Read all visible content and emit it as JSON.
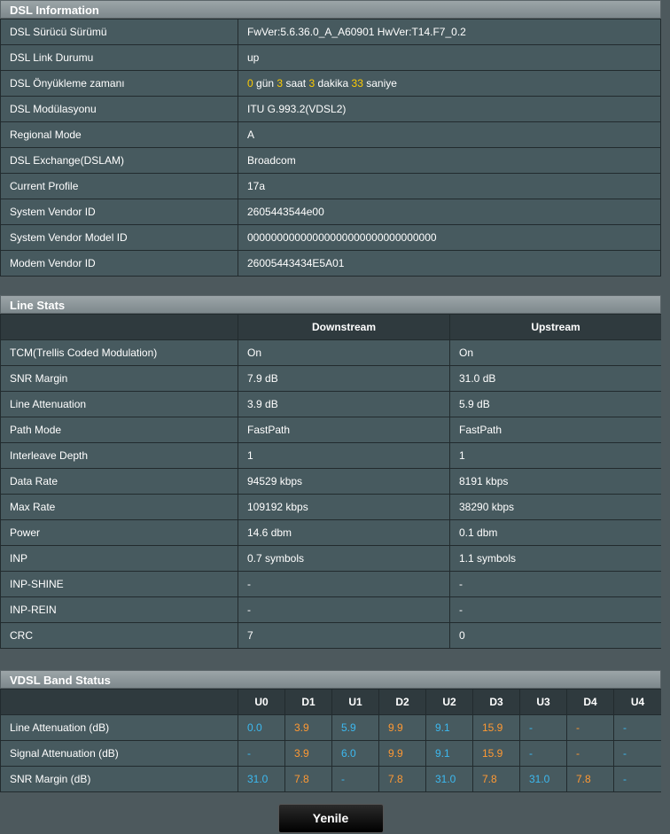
{
  "dsl_info": {
    "title": "DSL Information",
    "rows": [
      {
        "label": "DSL Sürücü Sürümü",
        "value": "FwVer:5.6.36.0_A_A60901 HwVer:T14.F7_0.2"
      },
      {
        "label": "DSL Link Durumu",
        "value": "up"
      },
      {
        "label": "DSL Önyükleme zamanı",
        "uptime": {
          "days": "0",
          "days_unit": "gün",
          "hours": "3",
          "hours_unit": "saat",
          "minutes": "3",
          "minutes_unit": "dakika",
          "seconds": "33",
          "seconds_unit": "saniye"
        }
      },
      {
        "label": "DSL Modülasyonu",
        "value": "ITU G.993.2(VDSL2)"
      },
      {
        "label": "Regional Mode",
        "value": "A"
      },
      {
        "label": "DSL Exchange(DSLAM)",
        "value": "Broadcom"
      },
      {
        "label": "Current Profile",
        "value": "17a"
      },
      {
        "label": "System Vendor ID",
        "value": "2605443544e00"
      },
      {
        "label": "System Vendor Model ID",
        "value": "00000000000000000000000000000000"
      },
      {
        "label": "Modem Vendor ID",
        "value": "26005443434E5A01"
      }
    ]
  },
  "line_stats": {
    "title": "Line Stats",
    "col_downstream": "Downstream",
    "col_upstream": "Upstream",
    "rows": [
      {
        "label": "TCM(Trellis Coded Modulation)",
        "down": "On",
        "up": "On"
      },
      {
        "label": "SNR Margin",
        "down": "7.9 dB",
        "up": "31.0 dB"
      },
      {
        "label": "Line Attenuation",
        "down": "3.9 dB",
        "up": "5.9 dB"
      },
      {
        "label": "Path Mode",
        "down": "FastPath",
        "up": "FastPath"
      },
      {
        "label": "Interleave Depth",
        "down": "1",
        "up": "1"
      },
      {
        "label": "Data Rate",
        "down": "94529 kbps",
        "up": "8191 kbps"
      },
      {
        "label": "Max Rate",
        "down": "109192 kbps",
        "up": "38290 kbps"
      },
      {
        "label": "Power",
        "down": "14.6 dbm",
        "up": "0.1 dbm"
      },
      {
        "label": "INP",
        "down": "0.7 symbols",
        "up": "1.1 symbols"
      },
      {
        "label": "INP-SHINE",
        "down": "-",
        "up": "-"
      },
      {
        "label": "INP-REIN",
        "down": "-",
        "up": "-"
      },
      {
        "label": "CRC",
        "down": "7",
        "up": "0"
      }
    ]
  },
  "band_status": {
    "title": "VDSL Band Status",
    "bands": [
      "U0",
      "D1",
      "U1",
      "D2",
      "U2",
      "D3",
      "U3",
      "D4",
      "U4"
    ],
    "rows": [
      {
        "label": "Line Attenuation (dB)",
        "values": [
          "0.0",
          "3.9",
          "5.9",
          "9.9",
          "9.1",
          "15.9",
          "-",
          "-",
          "-"
        ]
      },
      {
        "label": "Signal Attenuation (dB)",
        "values": [
          "-",
          "3.9",
          "6.0",
          "9.9",
          "9.1",
          "15.9",
          "-",
          "-",
          "-"
        ]
      },
      {
        "label": "SNR Margin (dB)",
        "values": [
          "31.0",
          "7.8",
          "-",
          "7.8",
          "31.0",
          "7.8",
          "31.0",
          "7.8",
          "-"
        ]
      }
    ],
    "colors": {
      "upstream": "#3cb9f0",
      "downstream": "#ff9933"
    }
  },
  "refresh_button": "Yenile"
}
